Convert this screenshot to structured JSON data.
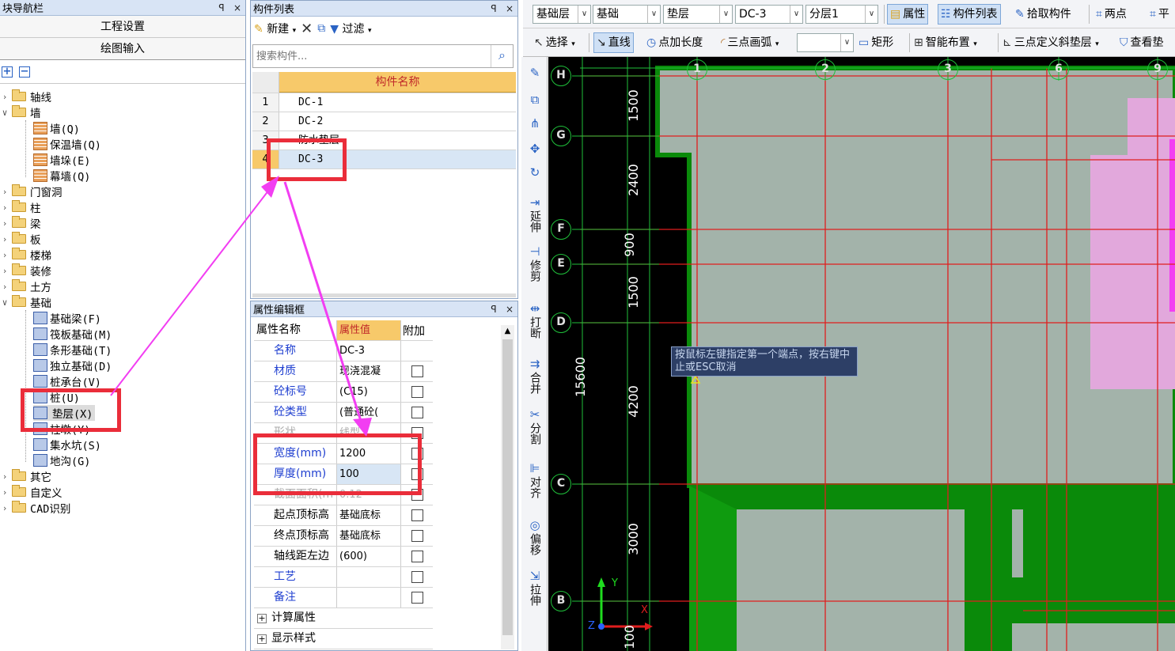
{
  "nav": {
    "title": "块导航栏",
    "pin": "ꟼ",
    "close": "×",
    "btn_project": "工程设置",
    "btn_draw": "绘图输入",
    "tree": [
      {
        "label": "轴线",
        "level": 0,
        "type": "folder",
        "expanded": false
      },
      {
        "label": "墙",
        "level": 0,
        "type": "folder",
        "expanded": true
      },
      {
        "label": "墙(Q)",
        "level": 1,
        "type": "wall"
      },
      {
        "label": "保温墙(Q)",
        "level": 1,
        "type": "wall"
      },
      {
        "label": "墙垛(E)",
        "level": 1,
        "type": "wall"
      },
      {
        "label": "幕墙(Q)",
        "level": 1,
        "type": "wall"
      },
      {
        "label": "门窗洞",
        "level": 0,
        "type": "folder",
        "expanded": false
      },
      {
        "label": "柱",
        "level": 0,
        "type": "folder",
        "expanded": false
      },
      {
        "label": "梁",
        "level": 0,
        "type": "folder",
        "expanded": false
      },
      {
        "label": "板",
        "level": 0,
        "type": "folder",
        "expanded": false
      },
      {
        "label": "楼梯",
        "level": 0,
        "type": "folder",
        "expanded": false
      },
      {
        "label": "装修",
        "level": 0,
        "type": "folder",
        "expanded": false
      },
      {
        "label": "土方",
        "level": 0,
        "type": "folder",
        "expanded": false
      },
      {
        "label": "基础",
        "level": 0,
        "type": "folder",
        "expanded": true
      },
      {
        "label": "基础梁(F)",
        "level": 1,
        "type": "comp"
      },
      {
        "label": "筏板基础(M)",
        "level": 1,
        "type": "comp"
      },
      {
        "label": "条形基础(T)",
        "level": 1,
        "type": "comp"
      },
      {
        "label": "独立基础(D)",
        "level": 1,
        "type": "comp"
      },
      {
        "label": "桩承台(V)",
        "level": 1,
        "type": "comp"
      },
      {
        "label": "桩(U)",
        "level": 1,
        "type": "comp"
      },
      {
        "label": "垫层(X)",
        "level": 1,
        "type": "comp",
        "selected": true
      },
      {
        "label": "柱墩(Y)",
        "level": 1,
        "type": "comp"
      },
      {
        "label": "集水坑(S)",
        "level": 1,
        "type": "comp"
      },
      {
        "label": "地沟(G)",
        "level": 1,
        "type": "comp"
      },
      {
        "label": "其它",
        "level": 0,
        "type": "folder",
        "expanded": false
      },
      {
        "label": "自定义",
        "level": 0,
        "type": "folder",
        "expanded": false
      },
      {
        "label": "CAD识别",
        "level": 0,
        "type": "folder",
        "expanded": false
      }
    ]
  },
  "list": {
    "title": "构件列表",
    "new": "新建",
    "filter": "过滤",
    "search_placeholder": "搜索构件...",
    "column": "构件名称",
    "rows": [
      {
        "num": "1",
        "name": "DC-1"
      },
      {
        "num": "2",
        "name": "DC-2"
      },
      {
        "num": "3",
        "name": "防水垫层"
      },
      {
        "num": "4",
        "name": "DC-3",
        "selected": true
      }
    ]
  },
  "prop": {
    "title": "属性编辑框",
    "hdr_name": "属性名称",
    "hdr_value": "属性值",
    "hdr_extra": "附加",
    "rows": [
      {
        "name": "名称",
        "value": "DC-3",
        "style": "blue",
        "check": false
      },
      {
        "name": "材质",
        "value": "现浇混凝",
        "style": "blue",
        "check": true
      },
      {
        "name": "砼标号",
        "value": "(C15)",
        "style": "blue",
        "check": true
      },
      {
        "name": "砼类型",
        "value": "(普通砼(",
        "style": "blue",
        "check": true
      },
      {
        "name": "形状",
        "value": "线型",
        "style": "gray",
        "check": true
      },
      {
        "name": "宽度(mm)",
        "value": "1200",
        "style": "blue",
        "check": true
      },
      {
        "name": "厚度(mm)",
        "value": "100",
        "style": "blue",
        "check": true,
        "selected": true
      },
      {
        "name": "截面面积(m",
        "value": "0.12",
        "style": "gray",
        "check": true
      },
      {
        "name": "起点顶标高",
        "value": "基础底标",
        "style": "black",
        "check": true
      },
      {
        "name": "终点顶标高",
        "value": "基础底标",
        "style": "black",
        "check": true
      },
      {
        "name": "轴线距左边",
        "value": "(600)",
        "style": "black",
        "check": true
      },
      {
        "name": "工艺",
        "value": "",
        "style": "blue",
        "check": true
      },
      {
        "name": "备注",
        "value": "",
        "style": "blue",
        "check": true
      }
    ],
    "groups": [
      "计算属性",
      "显示样式"
    ]
  },
  "toolbar1": {
    "floor": "基础层",
    "category": "基础",
    "type": "垫层",
    "component": "DC-3",
    "layer": "分层1",
    "attr": "属性",
    "complist": "构件列表",
    "pick": "拾取构件",
    "twopoint": "两点",
    "parallel": "平"
  },
  "toolbar2": {
    "select": "选择",
    "line": "直线",
    "pointlen": "点加长度",
    "arc": "三点画弧",
    "rect": "矩形",
    "smart": "智能布置",
    "slope": "三点定义斜垫层",
    "view": "查看垫"
  },
  "vtool": [
    {
      "label": "延伸",
      "icon": "⇥"
    },
    {
      "label": "修剪",
      "icon": "⊣"
    },
    {
      "label": "打断",
      "icon": "⇹"
    },
    {
      "label": "合并",
      "icon": "⇉"
    },
    {
      "label": "分割",
      "icon": "✂"
    },
    {
      "label": "对齐",
      "icon": "⊫"
    },
    {
      "label": "偏移",
      "icon": "◎"
    },
    {
      "label": "拉伸",
      "icon": "⇲"
    }
  ],
  "canvas": {
    "axes_top": [
      "1",
      "2",
      "3",
      "6",
      "9"
    ],
    "axes_left": [
      "H",
      "G",
      "F",
      "E",
      "D",
      "C",
      "B"
    ],
    "dims": [
      "1500",
      "2400",
      "900",
      "1500",
      "4200",
      "3000",
      "100"
    ],
    "total_dim": "15600",
    "tooltip": "按鼠标左键指定第一个端点，按右键中止或ESC取消",
    "axis_y": "Y",
    "axis_x": "X",
    "axis_z": "Z"
  },
  "colors": {
    "annotation_red": "#ea2d3a",
    "arrow_magenta": "#f23ef2",
    "grid_red": "#e01e1e",
    "slab_gray": "#a3b3aa",
    "green": "#0a8a0a",
    "pink": "#e2a8dc"
  }
}
